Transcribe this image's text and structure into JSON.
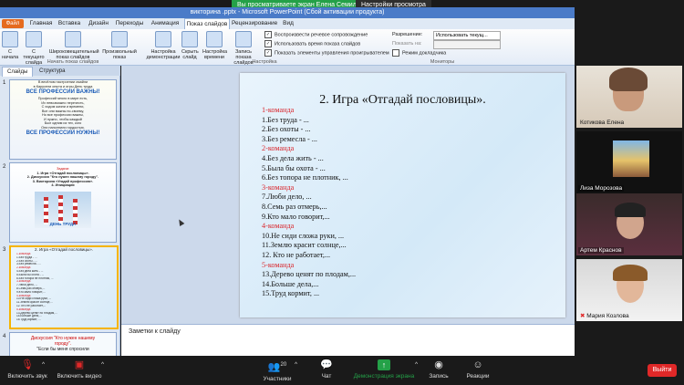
{
  "zoom": {
    "viewing_banner": "Вы просматриваете экран Елена Семилет",
    "view_options": "Настройки просмотра",
    "toolbar": {
      "mute_label": "Включить звук",
      "video_label": "Включить видео",
      "participants_label": "Участники",
      "participants_count": "20",
      "chat_label": "Чат",
      "share_label": "Демонстрация экрана",
      "record_label": "Запись",
      "reactions_label": "Реакции",
      "leave_label": "Выйти"
    },
    "participants": [
      {
        "name": "Котикова Елена"
      },
      {
        "name": "Лиза Морозова"
      },
      {
        "name": "Артем Краснов"
      },
      {
        "name": "Мария Козлова"
      }
    ]
  },
  "powerpoint": {
    "title": "викторина .pptx - Microsoft PowerPoint (Сбой активации продукта)",
    "file_button": "Файл",
    "tabs": [
      "Главная",
      "Вставка",
      "Дизайн",
      "Переходы",
      "Анимация",
      "Показ слайдов",
      "Рецензирование",
      "Вид"
    ],
    "active_tab": "Показ слайдов",
    "ribbon": {
      "buttons": [
        {
          "label": "С начала"
        },
        {
          "label": "С текущего слайда"
        },
        {
          "label": "Широковещательный показ слайдов"
        },
        {
          "label": "Произвольный показ"
        },
        {
          "label": "Настройка демонстрации"
        },
        {
          "label": "Скрыть слайд"
        },
        {
          "label": "Настройка времени"
        },
        {
          "label": "Запись показа слайдов"
        }
      ],
      "checkboxes": [
        {
          "label": "Воспроизвести речевое сопровождение",
          "checked": true
        },
        {
          "label": "Использовать время показа слайдов",
          "checked": true
        },
        {
          "label": "Показать элементы управления проигрывателем",
          "checked": true
        }
      ],
      "resolution_label": "Разрешение:",
      "resolution_value": "Использовать текущ...",
      "show_on_label": "Показать на:",
      "presenter_mode_label": "Режим докладчика",
      "group_start": "Начать показ слайдов",
      "group_setup": "Настройка",
      "group_monitors": "Мониторы"
    },
    "panel_tabs": [
      "Слайды",
      "Структура"
    ],
    "thumbnails": [
      {
        "number": "1",
        "lines": [
          "В весёлом настроении смайли",
          "в Карусели опыта и игры День труда",
          "ВСЕ ПРОФЕССИИ ВАЖНЫ!",
          "Профессий много в мире есть,",
          "Их невозможно перечесть,",
          "С ходом жизни и времени,",
          "Все они важны по-своему,",
          "Но все профессии важны,",
          "И нужно, чтобы каждый",
          "Был одним из тех, кого",
          "Они наполнили гордостью.",
          "ВСЕ ПРОФЕССИИ НУЖНЫ!"
        ]
      },
      {
        "number": "2",
        "lines": [
          "Задачи:",
          "1. Игра «Отгадай пословицы».",
          "2. Дискуссия \"Кто нужен нашему городу\".",
          "3. Викторина «Угадай профессию».",
          "4. Инициация",
          "ДЕНЬ ТРУДА"
        ]
      },
      {
        "number": "3",
        "lines": [
          "2. Игра «Отгадай пословицы».",
          "1-команда",
          "1.Без труда - ...",
          "2.Без охоты - ...",
          "3.Без ремесла - ...",
          "2-команда",
          "4.Без дела жить - ...",
          "5.Была бы охота - ...",
          "6.Без топора не плотник, ...",
          "3-команда",
          "7.Люби дело, ...",
          "8.Семь раз отмерь,...",
          "9.Кто мало говорит,...",
          "4-команда",
          "10.Не сиди сложа руки, ...",
          "11.Землю красит солнце,...",
          "12. Кто не работает,...",
          "5-команда",
          "13.Дерево ценят по плодам,...",
          "14.Больше дела,...",
          "15.Труд кормит, ..."
        ]
      },
      {
        "number": "4",
        "lines": [
          "Дискуссия \"Кто нужен нашему",
          "городу\".",
          "\"Если бы меня спросили"
        ]
      }
    ],
    "slide": {
      "title": "2. Игра «Отгадай пословицы».",
      "lines": [
        {
          "text": "1-команда",
          "type": "team"
        },
        {
          "text": "1.Без труда - ...",
          "type": "item"
        },
        {
          "text": "2.Без охоты - ...",
          "type": "item"
        },
        {
          "text": "3.Без ремесла - ...",
          "type": "item"
        },
        {
          "text": "2-команда",
          "type": "team"
        },
        {
          "text": "4.Без дела жить - ...",
          "type": "item"
        },
        {
          "text": "5.Была бы охота - ...",
          "type": "item"
        },
        {
          "text": "6.Без топора не плотник, ...",
          "type": "item"
        },
        {
          "text": "3-команда",
          "type": "team"
        },
        {
          "text": "7.Люби дело, ...",
          "type": "item"
        },
        {
          "text": "8.Семь раз отмерь,...",
          "type": "item"
        },
        {
          "text": "9.Кто мало говорит,...",
          "type": "item"
        },
        {
          "text": "4-команда",
          "type": "team"
        },
        {
          "text": "10.Не сиди сложа руки, ...",
          "type": "item"
        },
        {
          "text": "11.Землю красит солнце,...",
          "type": "item"
        },
        {
          "text": "12. Кто не работает,...",
          "type": "item"
        },
        {
          "text": " 5-команда",
          "type": "team"
        },
        {
          "text": "13.Дерево ценят по плодам,...",
          "type": "item"
        },
        {
          "text": "14.Больше дела,...",
          "type": "item"
        },
        {
          "text": "15.Труд кормит, ...",
          "type": "item"
        }
      ]
    },
    "notes_placeholder": "Заметки к слайду"
  },
  "colors": {
    "team_red": "#d9262c",
    "zoom_green": "#24a148",
    "leave_red": "#e02828"
  }
}
